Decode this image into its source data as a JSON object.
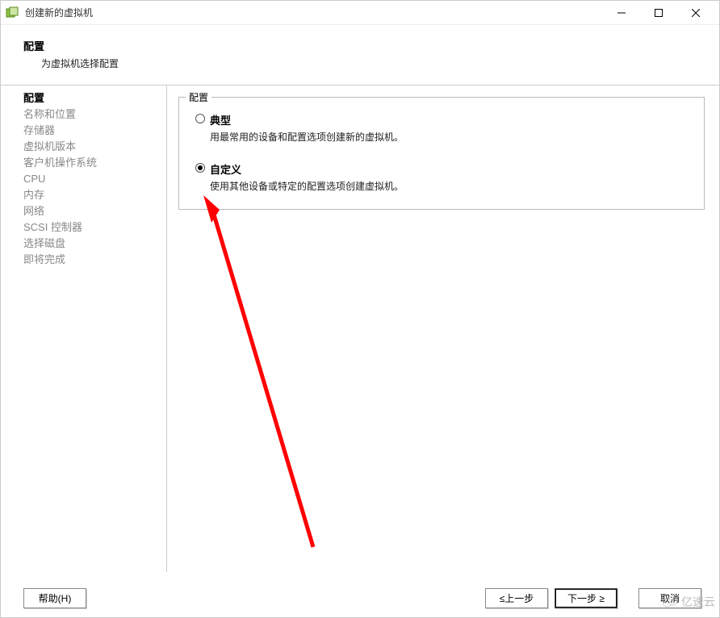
{
  "window": {
    "title": "创建新的虚拟机"
  },
  "header": {
    "heading": "配置",
    "subheading": "为虚拟机选择配置"
  },
  "sidebar": {
    "steps": [
      {
        "label": "配置",
        "current": true
      },
      {
        "label": "名称和位置",
        "current": false
      },
      {
        "label": "存储器",
        "current": false
      },
      {
        "label": "虚拟机版本",
        "current": false
      },
      {
        "label": "客户机操作系统",
        "current": false
      },
      {
        "label": "CPU",
        "current": false
      },
      {
        "label": "内存",
        "current": false
      },
      {
        "label": "网络",
        "current": false
      },
      {
        "label": "SCSI 控制器",
        "current": false
      },
      {
        "label": "选择磁盘",
        "current": false
      },
      {
        "label": "即将完成",
        "current": false
      }
    ]
  },
  "config": {
    "legend": "配置",
    "options": [
      {
        "label": "典型",
        "desc": "用最常用的设备和配置选项创建新的虚拟机。",
        "selected": false
      },
      {
        "label": "自定义",
        "desc": "使用其他设备或特定的配置选项创建虚拟机。",
        "selected": true
      }
    ]
  },
  "footer": {
    "help": "帮助(H)",
    "back": "≤上一步",
    "next": "下一步 ≥",
    "cancel": "取消"
  },
  "watermark": {
    "text": "亿速云"
  }
}
